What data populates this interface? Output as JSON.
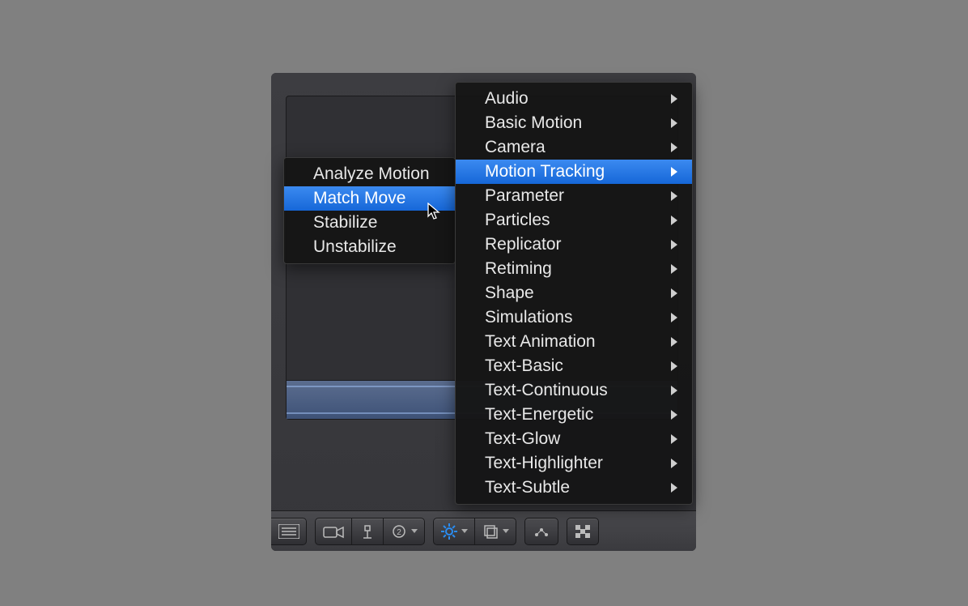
{
  "menu": {
    "items": [
      {
        "label": "Audio"
      },
      {
        "label": "Basic Motion"
      },
      {
        "label": "Camera"
      },
      {
        "label": "Motion Tracking",
        "highlight": true
      },
      {
        "label": "Parameter"
      },
      {
        "label": "Particles"
      },
      {
        "label": "Replicator"
      },
      {
        "label": "Retiming"
      },
      {
        "label": "Shape"
      },
      {
        "label": "Simulations"
      },
      {
        "label": "Text Animation"
      },
      {
        "label": "Text-Basic"
      },
      {
        "label": "Text-Continuous"
      },
      {
        "label": "Text-Energetic"
      },
      {
        "label": "Text-Glow"
      },
      {
        "label": "Text-Highlighter"
      },
      {
        "label": "Text-Subtle"
      }
    ]
  },
  "submenu": {
    "items": [
      {
        "label": "Analyze Motion"
      },
      {
        "label": "Match Move",
        "highlight": true
      },
      {
        "label": "Stabilize"
      },
      {
        "label": "Unstabilize"
      }
    ]
  },
  "toolbar": {
    "buttons": [
      "list-view",
      "camera",
      "add-light",
      "add-generator",
      "behaviors",
      "filters",
      "make-particles",
      "hud"
    ]
  },
  "colors": {
    "highlight": "#1f72e6",
    "menu_bg": "#161616",
    "page_bg": "#808080"
  }
}
